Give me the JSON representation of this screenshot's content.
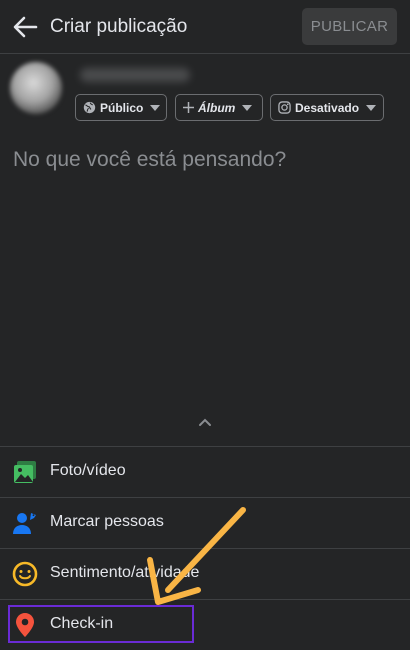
{
  "header": {
    "title": "Criar publicação",
    "publish_label": "PUBLICAR"
  },
  "audience": {
    "privacy_label": "Público",
    "album_label": "Álbum",
    "instagram_label": "Desativado"
  },
  "composer": {
    "placeholder": "No que você está pensando?"
  },
  "menu": {
    "items": [
      {
        "label": "Foto/vídeo",
        "icon": "photo-video-icon",
        "color": "#45bd62"
      },
      {
        "label": "Marcar pessoas",
        "icon": "tag-people-icon",
        "color": "#1877f2"
      },
      {
        "label": "Sentimento/atividade",
        "icon": "feeling-icon",
        "color": "#f7b928"
      },
      {
        "label": "Check-in",
        "icon": "location-pin-icon",
        "color": "#f5533d"
      }
    ]
  },
  "annotation": {
    "highlight_color": "#6a2bd6",
    "arrow_color": "#f9b545"
  }
}
